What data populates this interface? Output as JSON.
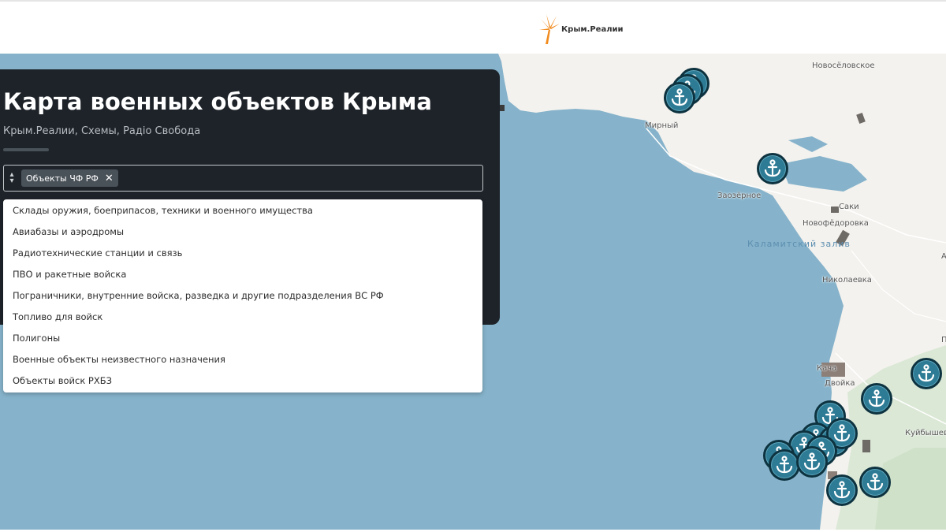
{
  "header": {
    "logo_text": "Крым.Реалии",
    "logo_icon": "sunburst-logo",
    "logo_color": "#f28b1e"
  },
  "panel": {
    "title": "Карта военных объектов Крыма",
    "subtitle": "Крым.Реалии, Схемы, Радіо Свобода",
    "filter": {
      "selected_chip": "Объекты ЧФ РФ",
      "remove_icon": "close-icon"
    },
    "options": [
      "Склады оружия, боеприпасов, техники и военного имущества",
      "Авиабазы и аэродромы",
      "Радиотехнические станции и связь",
      "ПВО и ракетные войска",
      "Пограничники, внутренние войска, разведка и другие подразделения ВС РФ",
      "Топливо для войск",
      "Полигоны",
      "Военные объекты неизвестного назначения",
      "Объекты войск РХБЗ"
    ]
  },
  "map": {
    "water_color": "#86b3cb",
    "land_color": "#f4f2ee",
    "marker_color": "#2e7b95",
    "marker_icon": "anchor-icon",
    "places": [
      "Новосёловское",
      "Мирный",
      "Заозёрное",
      "Саки",
      "Новофёдоровка",
      "Николаевка",
      "Кача",
      "Двойка",
      "Куйбышево"
    ],
    "water_labels": [
      "Каламитский залив"
    ],
    "edge_fragments": [
      "А",
      "П"
    ]
  }
}
